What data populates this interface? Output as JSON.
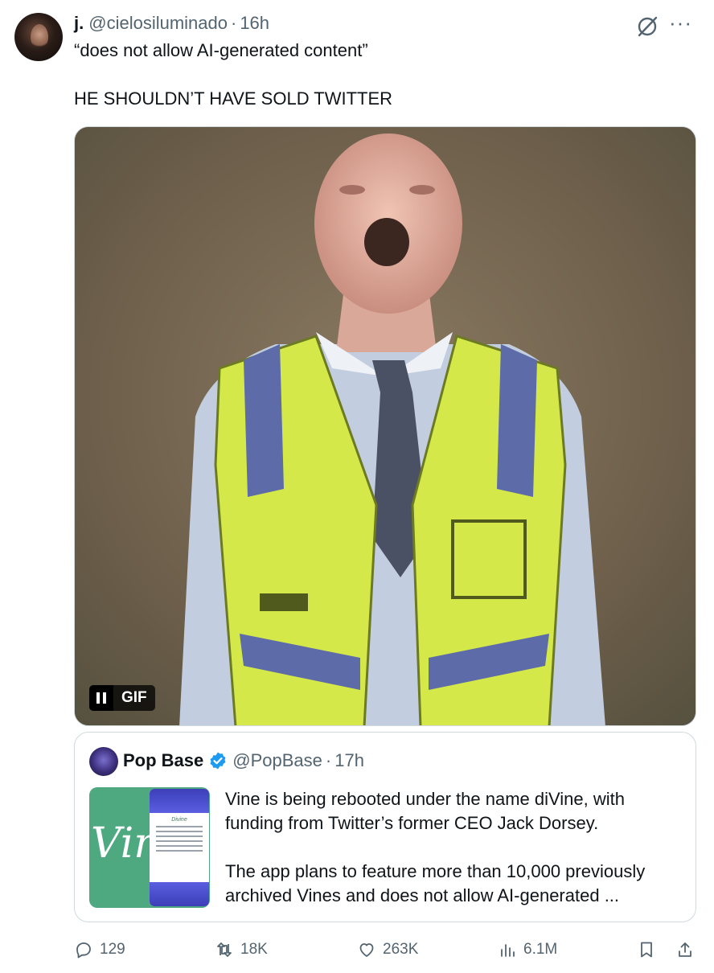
{
  "tweet": {
    "display_name": "j.",
    "handle": "@cielosiluminado",
    "separator": "·",
    "time": "16h",
    "text_line1": "“does not allow AI-generated content”",
    "text_line2": "HE SHOULDN’T HAVE SOLD TWITTER",
    "icons": [
      "grok-icon",
      "more-icon"
    ]
  },
  "media": {
    "badge_label": "GIF",
    "pause_icon": "pause-icon"
  },
  "quote": {
    "display_name": "Pop Base",
    "verified": true,
    "verified_color": "#1d9bf0",
    "handle": "@PopBase",
    "separator": "·",
    "time": "17h",
    "text_p1": "Vine is being rebooted under the name diVine, with funding from Twitter’s former CEO Jack Dorsey.",
    "text_p2": "The app plans to feature more than 10,000 previously archived Vines and does not allow AI-generated ...",
    "thumb": {
      "logo_text": "Vin",
      "app_title": "Divine"
    }
  },
  "actions": {
    "replies": "129",
    "reposts": "18K",
    "likes": "263K",
    "views": "6.1M"
  },
  "colors": {
    "text": "#0f1419",
    "secondary": "#536471",
    "border": "#cfd9de",
    "vest": "#d4e84a",
    "thumb_green": "#4fa980"
  }
}
